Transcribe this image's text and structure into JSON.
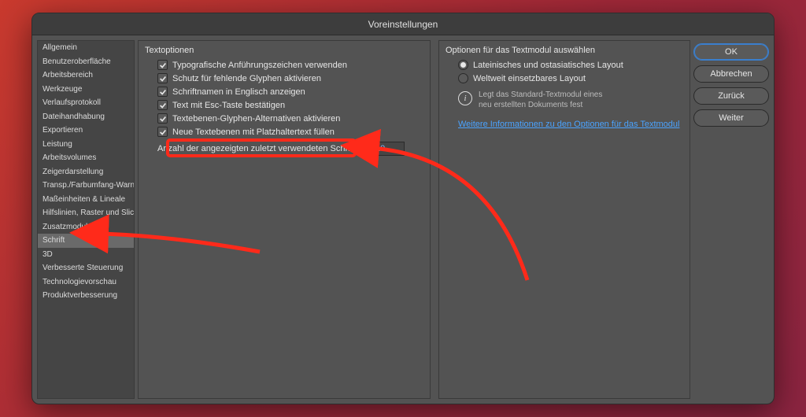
{
  "dialog": {
    "title": "Voreinstellungen"
  },
  "sidebar": {
    "items": [
      "Allgemein",
      "Benutzeroberfläche",
      "Arbeitsbereich",
      "Werkzeuge",
      "Verlaufsprotokoll",
      "Dateihandhabung",
      "Exportieren",
      "Leistung",
      "Arbeitsvolumes",
      "Zeigerdarstellung",
      "Transp./Farbumfang-Warnung",
      "Maßeinheiten & Lineale",
      "Hilfslinien, Raster und Slices",
      "Zusatzmodule",
      "Schrift",
      "3D",
      "Verbesserte Steuerung",
      "Technologievorschau",
      "Produktverbesserung"
    ],
    "selectedIndex": 14
  },
  "textOptions": {
    "title": "Textoptionen",
    "items": [
      {
        "label": "Typografische Anführungszeichen verwenden",
        "checked": true
      },
      {
        "label": "Schutz für fehlende Glyphen aktivieren",
        "checked": true
      },
      {
        "label": "Schriftnamen in Englisch anzeigen",
        "checked": true
      },
      {
        "label": "Text mit Esc-Taste bestätigen",
        "checked": true
      },
      {
        "label": "Textebenen-Glyphen-Alternativen aktivieren",
        "checked": true,
        "highlighted": true
      },
      {
        "label": "Neue Textebenen mit Platzhaltertext füllen",
        "checked": true
      }
    ],
    "recentFontsLabel": "Anzahl der angezeigten zuletzt verwendeten Schriften:",
    "recentFontsValue": "10"
  },
  "textModule": {
    "title": "Optionen für das Textmodul auswählen",
    "options": [
      {
        "label": "Lateinisches und ostasiatisches Layout",
        "selected": true
      },
      {
        "label": "Weltweit einsetzbares Layout",
        "selected": false
      }
    ],
    "infoLine1": "Legt das Standard-Textmodul eines",
    "infoLine2": "neu erstellten Dokuments fest",
    "linkText": "Weitere Informationen zu den Optionen für das Textmodul"
  },
  "buttons": {
    "ok": "OK",
    "cancel": "Abbrechen",
    "prev": "Zurück",
    "next": "Weiter"
  }
}
